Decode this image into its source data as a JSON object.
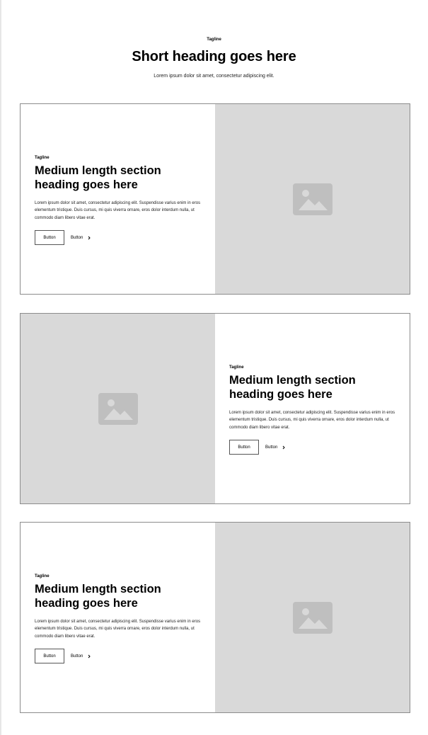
{
  "header": {
    "tagline": "Tagline",
    "title": "Short heading goes here",
    "description": "Lorem ipsum dolor sit amet, consectetur adipiscing elit."
  },
  "sections": [
    {
      "tagline": "Tagline",
      "heading": "Medium length section heading goes here",
      "body": "Lorem ipsum dolor sit amet, consectetur adipiscing elit. Suspendisse varius enim in eros elementum tristique. Duis cursus, mi quis viverra ornare, eros dolor interdum nulla, ut commodo diam libero vitae erat.",
      "primary_button": "Button",
      "link_button": "Button",
      "image_icon": "image-placeholder-icon"
    },
    {
      "tagline": "Tagline",
      "heading": "Medium length section heading goes here",
      "body": "Lorem ipsum dolor sit amet, consectetur adipiscing elit. Suspendisse varius enim in eros elementum tristique. Duis cursus, mi quis viverra ornare, eros dolor interdum nulla, ut commodo diam libero vitae erat.",
      "primary_button": "Button",
      "link_button": "Button",
      "image_icon": "image-placeholder-icon"
    },
    {
      "tagline": "Tagline",
      "heading": "Medium length section heading goes here",
      "body": "Lorem ipsum dolor sit amet, consectetur adipiscing elit. Suspendisse varius enim in eros elementum tristique. Duis cursus, mi quis viverra ornare, eros dolor interdum nulla, ut commodo diam libero vitae erat.",
      "primary_button": "Button",
      "link_button": "Button",
      "image_icon": "image-placeholder-icon"
    }
  ],
  "colors": {
    "placeholder_bg": "#d9d9d9",
    "placeholder_icon": "#bfbfbf",
    "card_border": "#8c8c8c"
  }
}
